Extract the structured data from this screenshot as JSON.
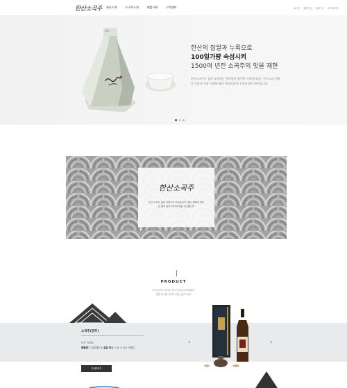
{
  "header": {
    "logo": "한산소곡주",
    "nav": [
      "회사소개",
      "소곡주소개",
      "제품구매",
      "고객센터"
    ],
    "util": [
      "로그인",
      "회원가입",
      "장바구니",
      "마이페이지"
    ]
  },
  "hero": {
    "line1": "한산의 찹쌀과 누룩으로",
    "line2": "100일가량 숙성시켜",
    "line3": "1500여 년전 소곡주의 맛을 재현",
    "desc": "한산소곡주는 물로 빚어내는 명주중의 명주로 기록되어있는 우리나라 전통주 가운데 가장 오래된 술로 역사만큼이나 맛과 향이 뛰어납니다"
  },
  "banner": {
    "logo": "한산소곡주",
    "desc": "한산 소곡주 공장 저장고의 모습입니다. 좋은 원료와 깨끗한 물로 빚어 최고의 맛을 선사합니다"
  },
  "product": {
    "title": "PRODUCT",
    "sub_line1": "\"1500년의 유구한 역사가 빚어낸 백제명주\"",
    "sub_line2": "전통 방식을 지키며 만든 한산소곡주",
    "name": "소곡주(명주)",
    "abv": "도수 16%",
    "desc_bold1": "한편희",
    "desc_mid": "가 설명해주는",
    "desc_bold2": "깊은 맛",
    "desc_end": "을 느낄 수 있는 전통주",
    "button": "자세히보기"
  },
  "icons": {
    "prev": "chevron-left-icon",
    "next": "chevron-right-icon"
  }
}
